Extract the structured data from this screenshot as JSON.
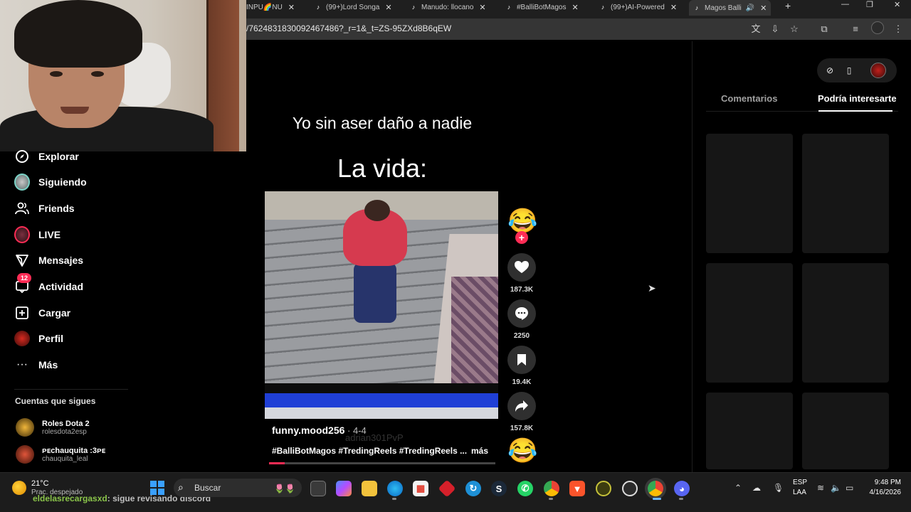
{
  "browser": {
    "tabs": [
      {
        "label": "INPU🌈NU"
      },
      {
        "label": "(99+)Lord Songa"
      },
      {
        "label": "Manudo: llocano"
      },
      {
        "label": "#BalliBotMagos"
      },
      {
        "label": "(99+)AI-Powered"
      },
      {
        "label": "Magos Balli"
      }
    ],
    "url": "/7624831830092467486?_r=1&_t=ZS-95ZXd8B6qEW"
  },
  "sidebar": {
    "items": [
      {
        "label": "Explorar",
        "icon": "compass-icon"
      },
      {
        "label": "Siguiendo",
        "icon": "following-avatar-icon"
      },
      {
        "label": "Friends",
        "icon": "friends-icon"
      },
      {
        "label": "LIVE",
        "icon": "live-icon"
      },
      {
        "label": "Mensajes",
        "icon": "send-icon"
      },
      {
        "label": "Actividad",
        "icon": "activity-icon",
        "badge": "12"
      },
      {
        "label": "Cargar",
        "icon": "upload-icon"
      },
      {
        "label": "Perfil",
        "icon": "profile-avatar-icon"
      },
      {
        "label": "Más",
        "icon": "more-icon"
      }
    ],
    "following_title": "Cuentas que sigues",
    "accounts": [
      {
        "name": "Roles Dota 2",
        "handle": "rolesdota2esp"
      },
      {
        "name": "ᴘᴇchauquita :3ᴘᴇ",
        "handle": "chauquita_leal"
      }
    ]
  },
  "video": {
    "caption_top": "Yo sin aser daño a nadie",
    "caption_big": "La vida:",
    "author": "funny.mood256",
    "date": " · 4-4",
    "ghost_text": "adrian301PvP",
    "tags": "#BalliBotMagos #TredingReels #TredingReels ...",
    "more": "más",
    "progress": 0.07
  },
  "actions": {
    "likes": "187.3K",
    "comments": "2250",
    "saves": "19.4K",
    "shares": "157.8K"
  },
  "right_panel": {
    "tabs": [
      {
        "label": "Comentarios",
        "active": false
      },
      {
        "label": "Podría interesarte",
        "active": true
      }
    ]
  },
  "taskbar": {
    "weather_temp": "21°C",
    "weather_desc": "Prac. despejado",
    "chat_user": "eldelasrecargasxd",
    "chat_text": ": sigue revisando discord",
    "search_label": "Buscar",
    "lang_top": "ESP",
    "lang_bottom": "LAA",
    "time": "9:48 PM",
    "date": "4/16/2026"
  },
  "colors": {
    "accent": "#fe2c55",
    "background": "#000000",
    "panel": "#161616"
  }
}
